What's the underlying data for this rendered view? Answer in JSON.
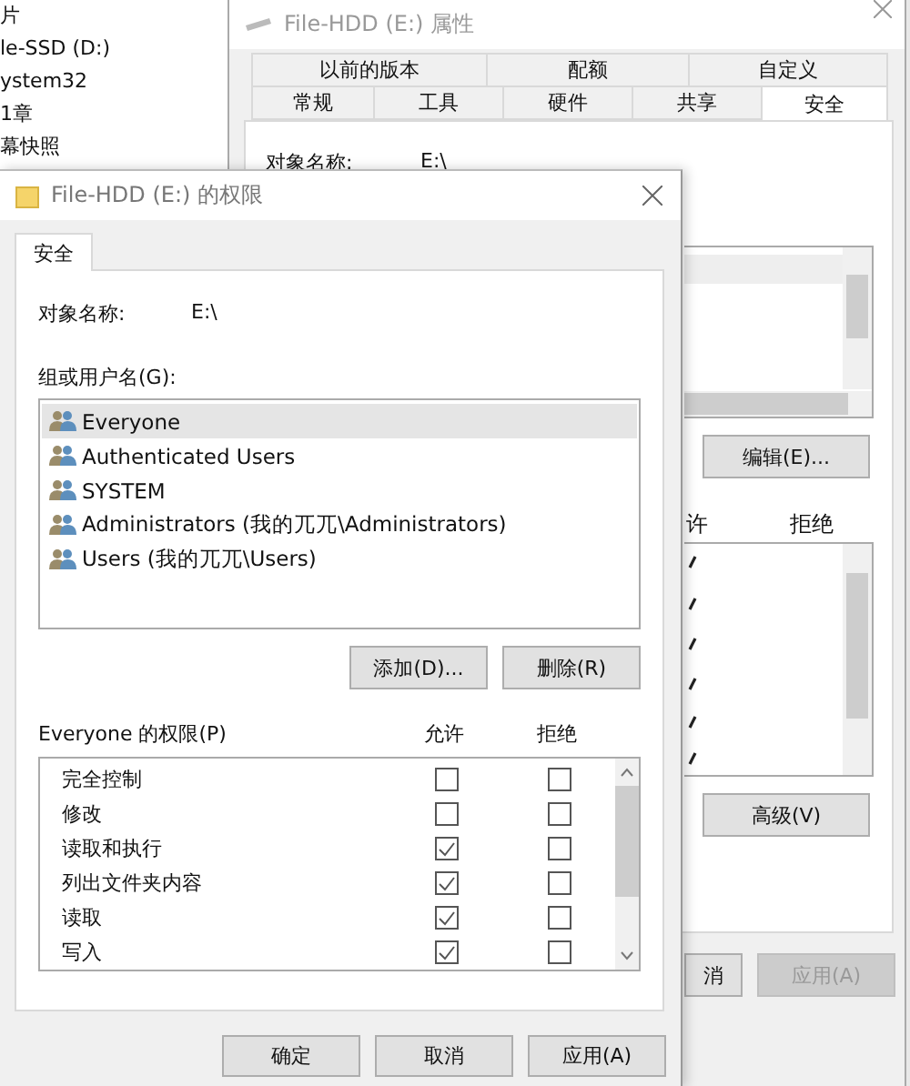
{
  "explorer": {
    "items": [
      "片",
      "le-SSD (D:)",
      "ystem32",
      "1章",
      "幕快照"
    ]
  },
  "back_window": {
    "title": "File-HDD (E:) 属性",
    "tabs_row1": [
      {
        "label": "以前的版本",
        "selected": false
      },
      {
        "label": "配额",
        "selected": false
      },
      {
        "label": "自定义",
        "selected": false
      }
    ],
    "tabs_row2": [
      {
        "label": "常规",
        "selected": false
      },
      {
        "label": "工具",
        "selected": false
      },
      {
        "label": "硬件",
        "selected": false
      },
      {
        "label": "共享",
        "selected": false
      },
      {
        "label": "安全",
        "selected": true
      }
    ],
    "object_label": "对象名称:",
    "object_value": "E:\\",
    "edit_button": "编辑(E)...",
    "allow_header": "许",
    "deny_header": "拒绝",
    "allow_checks": [
      true,
      true,
      true,
      true,
      true,
      true
    ],
    "advanced_button": "高级(V)",
    "buttons": [
      {
        "label": "消",
        "disabled": false
      },
      {
        "label": "应用(A)",
        "disabled": true
      }
    ]
  },
  "front_window": {
    "title": "File-HDD (E:) 的权限",
    "tabs": [
      {
        "label": "安全",
        "selected": true
      }
    ],
    "object_label": "对象名称:",
    "object_value": "E:\\",
    "group_label": "组或用户名(G):",
    "users": [
      {
        "name": "Everyone",
        "selected": true
      },
      {
        "name": "Authenticated Users",
        "selected": false
      },
      {
        "name": "SYSTEM",
        "selected": false
      },
      {
        "name": "Administrators (我的兀兀\\Administrators)",
        "selected": false
      },
      {
        "name": "Users (我的兀兀\\Users)",
        "selected": false
      }
    ],
    "add_button": "添加(D)...",
    "remove_button": "删除(R)",
    "permissions_label": "Everyone 的权限(P)",
    "allow_header": "允许",
    "deny_header": "拒绝",
    "permissions": [
      {
        "name": "完全控制",
        "allow": false,
        "deny": false
      },
      {
        "name": "修改",
        "allow": false,
        "deny": false
      },
      {
        "name": "读取和执行",
        "allow": true,
        "deny": false
      },
      {
        "name": "列出文件夹内容",
        "allow": true,
        "deny": false
      },
      {
        "name": "读取",
        "allow": true,
        "deny": false
      },
      {
        "name": "写入",
        "allow": true,
        "deny": false
      }
    ],
    "buttons": [
      {
        "label": "确定",
        "disabled": false
      },
      {
        "label": "取消",
        "disabled": false
      },
      {
        "label": "应用(A)",
        "disabled": false
      }
    ]
  }
}
